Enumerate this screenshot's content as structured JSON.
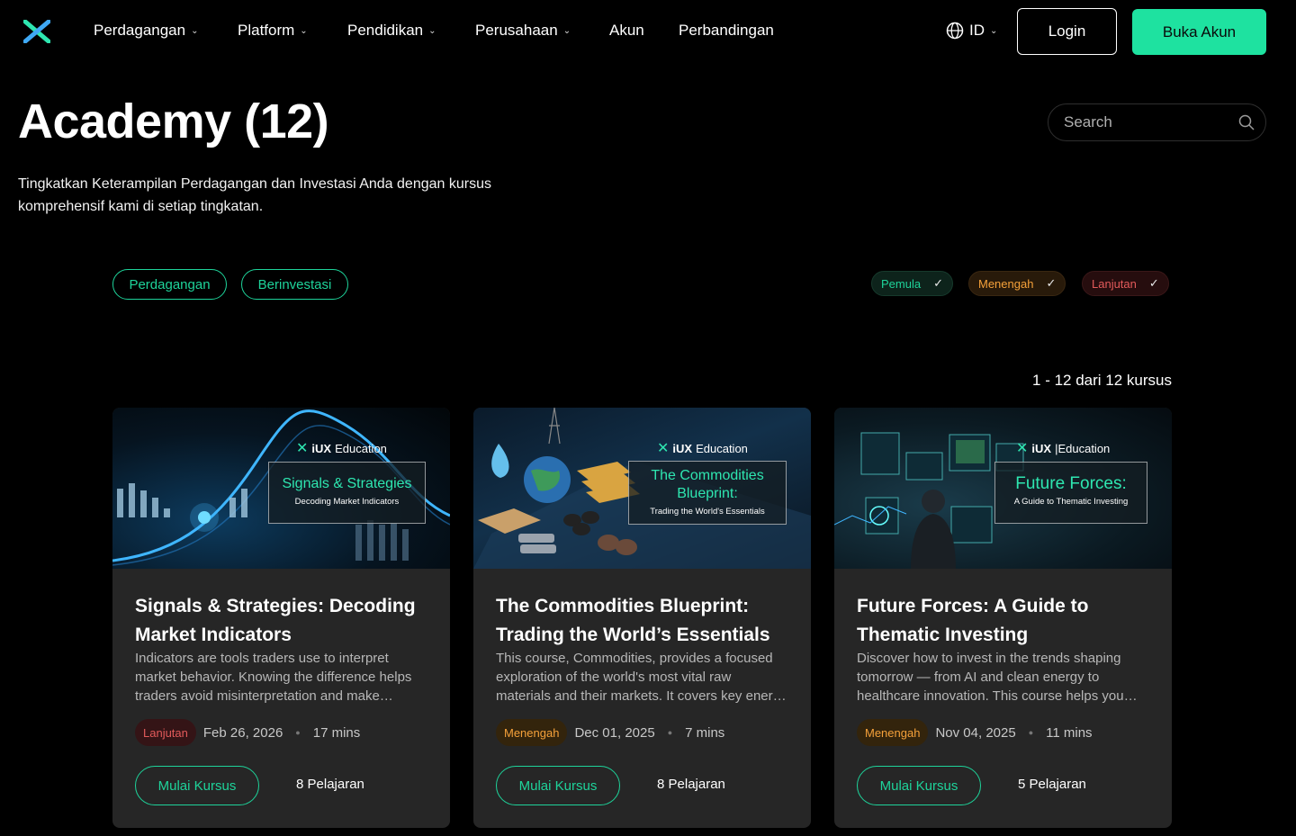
{
  "nav": {
    "items": [
      "Perdagangan",
      "Platform",
      "Pendidikan",
      "Perusahaan",
      "Akun",
      "Perbandingan"
    ],
    "lang": "ID",
    "login": "Login",
    "open_account": "Buka Akun"
  },
  "header": {
    "title": "Academy (12)",
    "subtitle": "Tingkatkan Keterampilan Perdagangan dan Investasi Anda dengan kursus komprehensif kami di setiap tingkatan.",
    "search_placeholder": "Search"
  },
  "filters": {
    "categories": [
      "Perdagangan",
      "Berinvestasi"
    ],
    "levels": [
      "Pemula",
      "Menengah",
      "Lanjutan"
    ]
  },
  "results": "1 - 12 dari 12 kursus",
  "cards": [
    {
      "img_brand": "iUX",
      "img_brand_suffix": "Education",
      "img_title": "Signals & Strategies",
      "img_sub": "Decoding Market Indicators",
      "title": "Signals & Strategies: Decoding Market Indicators",
      "desc": "Indicators are tools traders use to interpret market behavior. Knowing the difference helps traders avoid misinterpretation and make…",
      "level": "Lanjutan",
      "date": "Feb 26, 2026",
      "duration": "17 mins",
      "cta": "Mulai Kursus",
      "lessons": "8 Pelajaran"
    },
    {
      "img_brand": "iUX",
      "img_brand_suffix": "Education",
      "img_title": "The Commodities Blueprint:",
      "img_sub": "Trading the World's Essentials",
      "title": "The Commodities Blueprint: Trading the World’s Essentials",
      "desc": "This course, Commodities, provides a focused exploration of the world's most vital raw materials and their markets. It covers key ener…",
      "level": "Menengah",
      "date": "Dec 01, 2025",
      "duration": "7 mins",
      "cta": "Mulai Kursus",
      "lessons": "8 Pelajaran"
    },
    {
      "img_brand": "iUX",
      "img_brand_suffix": "|Education",
      "img_title": "Future Forces:",
      "img_sub": "A Guide to Thematic Investing",
      "title": "Future Forces: A Guide to Thematic Investing",
      "desc": "Discover how to invest in the trends shaping tomorrow — from AI and clean energy to healthcare innovation. This course helps you…",
      "level": "Menengah",
      "date": "Nov 04, 2025",
      "duration": "11 mins",
      "cta": "Mulai Kursus",
      "lessons": "5 Pelajaran"
    }
  ],
  "colors": {
    "accent": "#1ee2a0",
    "beginner": "#1ed39a",
    "intermediate": "#f5a13a",
    "advanced": "#e25a5a"
  }
}
